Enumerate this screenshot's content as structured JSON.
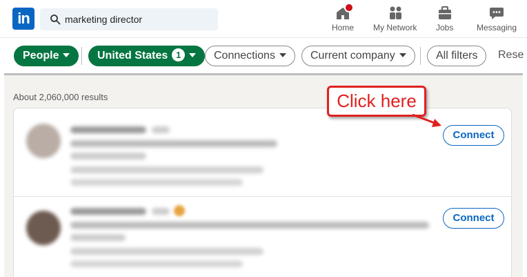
{
  "nav": {
    "logo_text": "in",
    "search_query": "marketing director",
    "items": [
      {
        "label": "Home",
        "icon": "home-icon"
      },
      {
        "label": "My Network",
        "icon": "network-icon"
      },
      {
        "label": "Jobs",
        "icon": "jobs-icon"
      },
      {
        "label": "Messaging",
        "icon": "messaging-icon"
      }
    ],
    "home_notification": true
  },
  "filters": {
    "people": "People",
    "location": "United States",
    "location_count": "1",
    "connections": "Connections",
    "current_company": "Current company",
    "all_filters": "All filters",
    "reset": "Rese"
  },
  "results": {
    "count_text": "About 2,060,000 results",
    "rows": [
      {
        "connect_label": "Connect"
      },
      {
        "connect_label": "Connect"
      }
    ]
  },
  "annotation": {
    "text": "Click here",
    "color": "#e02020"
  },
  "colors": {
    "brand_blue": "#0a66c2",
    "filter_green": "#057642"
  }
}
